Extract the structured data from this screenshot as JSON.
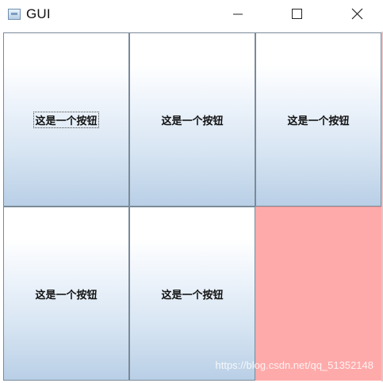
{
  "window": {
    "title": "GUI",
    "controls": {
      "minimize_icon": "minimize-icon",
      "maximize_icon": "maximize-icon",
      "close_icon": "close-icon"
    }
  },
  "buttons": [
    {
      "label": "这是一个按钮",
      "focused": true
    },
    {
      "label": "这是一个按钮",
      "focused": false
    },
    {
      "label": "这是一个按钮",
      "focused": false
    },
    {
      "label": "这是一个按钮",
      "focused": false
    },
    {
      "label": "这是一个按钮",
      "focused": false
    }
  ],
  "panel": {
    "color": "#ffaaaa"
  },
  "watermark": "https://blog.csdn.net/qq_51352148",
  "colors": {
    "button_gradient_top": "#ffffff",
    "button_gradient_bottom": "#b9cfe6",
    "button_border": "#7a8a99"
  }
}
